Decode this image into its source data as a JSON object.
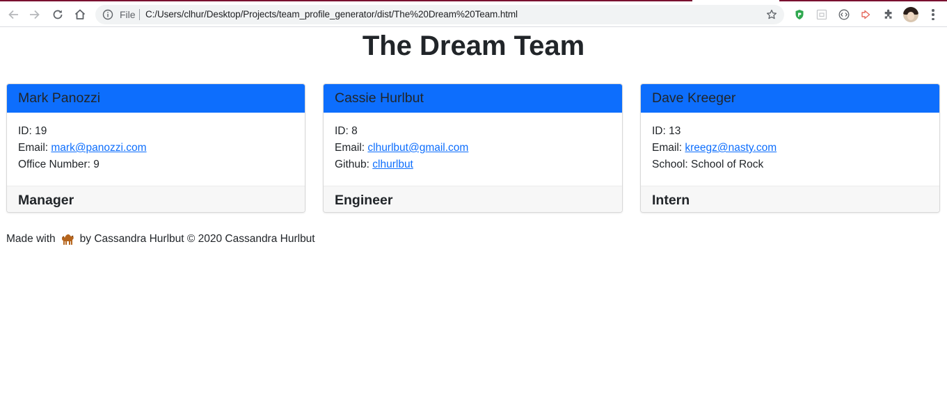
{
  "browser": {
    "address_prefix": "File",
    "url": "C:/Users/clhur/Desktop/Projects/team_profile_generator/dist/The%20Dream%20Team.html",
    "icons": [
      "back-icon",
      "forward-icon",
      "reload-icon",
      "home-icon",
      "info-icon",
      "star-icon",
      "shield-extension-icon",
      "box-extension-icon",
      "code-extension-icon",
      "arrow-extension-icon",
      "puzzle-icon",
      "avatar",
      "menu-icon"
    ]
  },
  "page": {
    "title": "The Dream Team"
  },
  "team": [
    {
      "name": "Mark Panozzi",
      "id_line": "ID: 19",
      "email_label": "Email: ",
      "email": "mark@panozzi.com",
      "extra_label": "Office Number: 9",
      "extra_link": "",
      "role": "Manager"
    },
    {
      "name": "Cassie Hurlbut",
      "id_line": "ID: 8",
      "email_label": "Email: ",
      "email": "clhurlbut@gmail.com",
      "extra_label": "Github: ",
      "extra_link": "clhurlbut",
      "role": "Engineer"
    },
    {
      "name": "Dave Kreeger",
      "id_line": "ID: 13",
      "email_label": "Email: ",
      "email": "kreegz@nasty.com",
      "extra_label": "School: School of Rock",
      "extra_link": "",
      "role": "Intern"
    }
  ],
  "footer": {
    "made_with": "Made with",
    "icon": "camel-icon",
    "credit": "by Cassandra Hurlbut © 2020 Cassandra Hurlbut"
  },
  "colors": {
    "header_bg": "#0d6efd",
    "link": "#0d6efd",
    "footer_bg": "#f7f7f7",
    "text": "#212529"
  }
}
